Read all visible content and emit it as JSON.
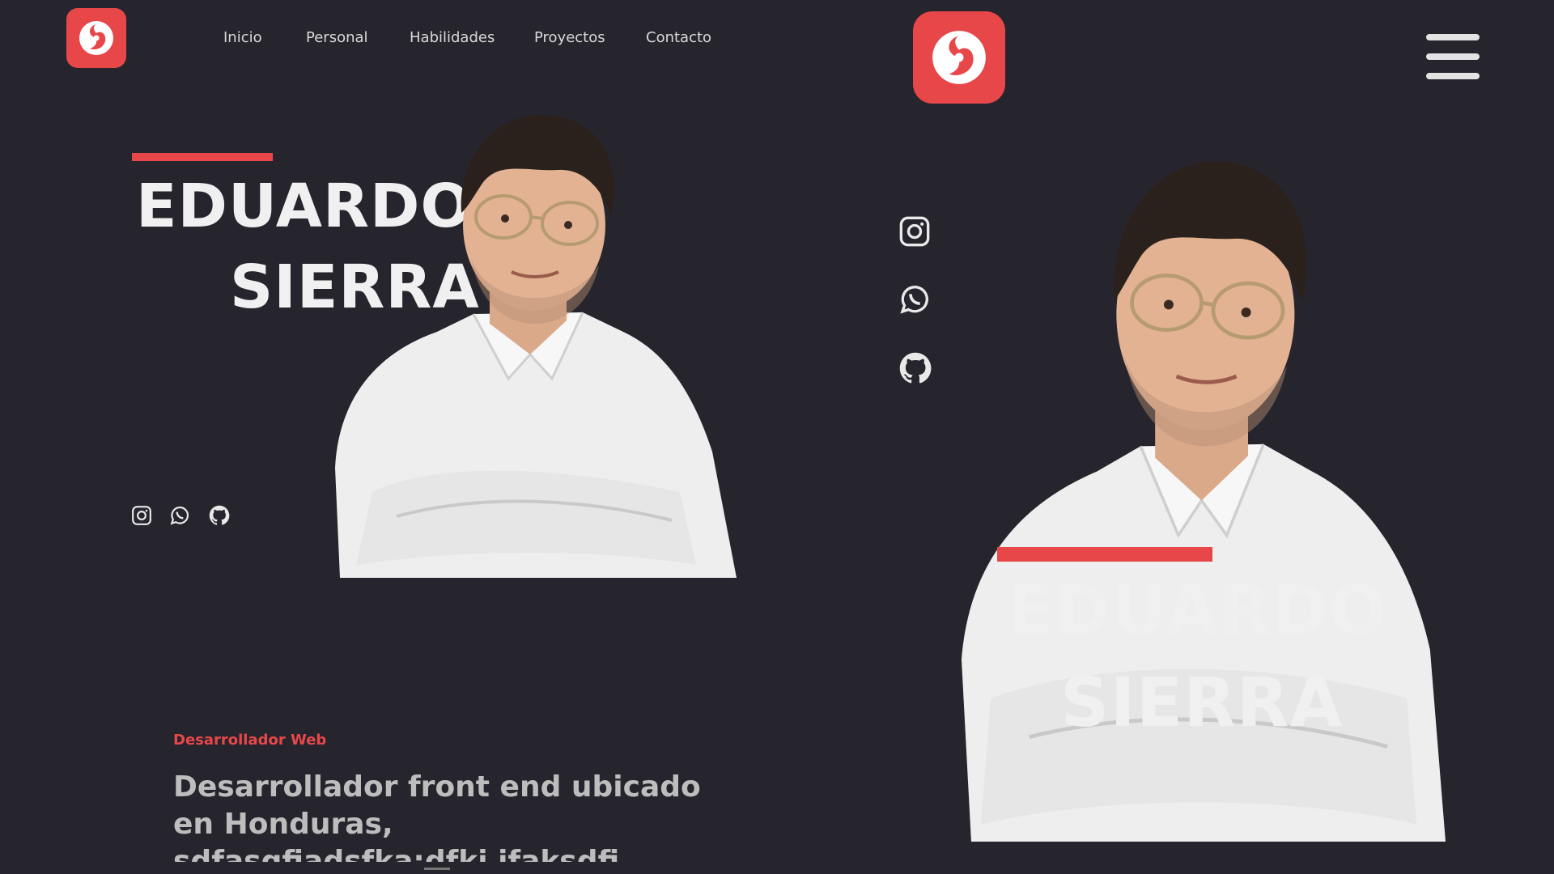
{
  "brand": {
    "accent": "#e8474a",
    "background": "#26252d",
    "icon": "swirl-logo-icon"
  },
  "nav": {
    "items": [
      {
        "label": "Inicio"
      },
      {
        "label": "Personal"
      },
      {
        "label": "Habilidades"
      },
      {
        "label": "Proyectos"
      },
      {
        "label": "Contacto"
      }
    ]
  },
  "hero_desktop": {
    "first_name": "EDUARDO",
    "last_name": "SIERRA",
    "social_icons": [
      "instagram-icon",
      "whatsapp-icon",
      "github-icon"
    ]
  },
  "about": {
    "role": "Desarrollador Web",
    "description": "Desarrollador front end ubicado en Honduras, sdfasgfiadsfka;dfkj ifaksdfi asiflkas fjkj fa sdfk"
  },
  "hero_mobile": {
    "first_name": "EDUARDO",
    "last_name": "SIERRA",
    "menu_icon": "hamburger-menu-icon",
    "social_icons": [
      "instagram-icon",
      "whatsapp-icon",
      "github-icon"
    ]
  }
}
